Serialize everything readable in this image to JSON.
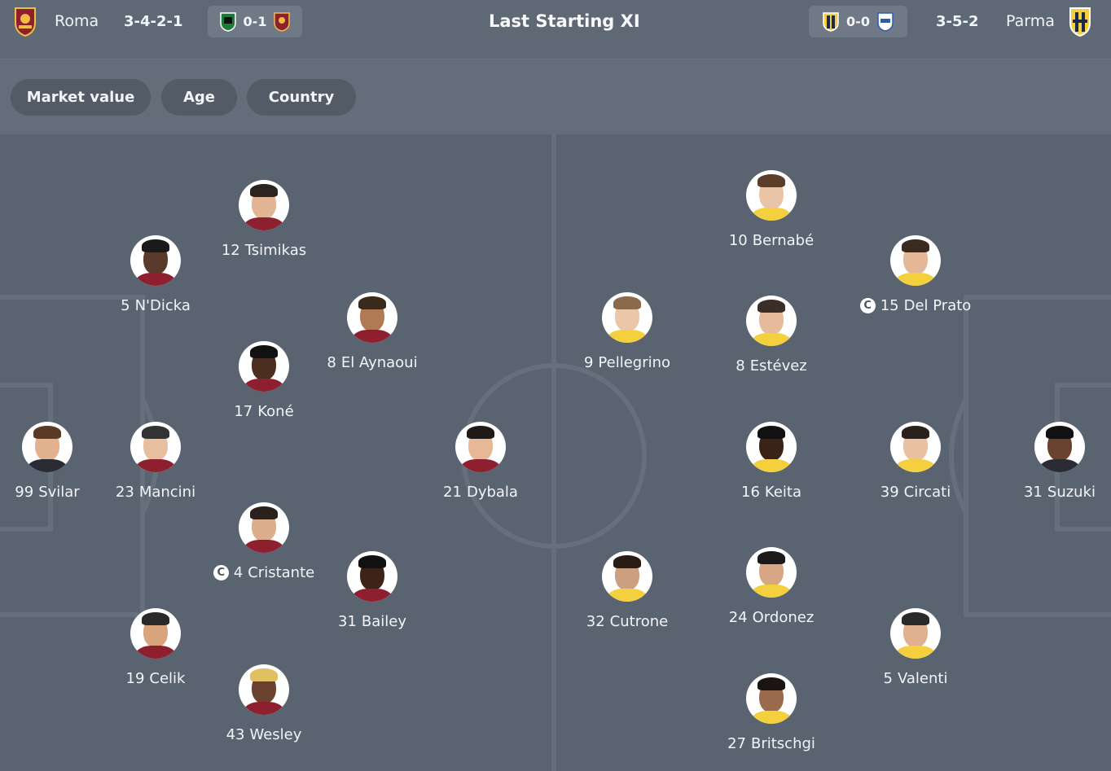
{
  "header": {
    "home": {
      "name": "Roma",
      "formation": "3-4-2-1",
      "last_result": "0-1"
    },
    "title": "Last Starting XI",
    "away": {
      "name": "Parma",
      "formation": "3-5-2",
      "last_result": "0-0"
    }
  },
  "filters": [
    {
      "label": "Market value"
    },
    {
      "label": "Age"
    },
    {
      "label": "Country"
    }
  ],
  "colors": {
    "background": "#5a6370",
    "header": "#5f6875",
    "chip": "#535b67",
    "roma_red": "#8e1f2f",
    "roma_gold": "#f0bc42",
    "parma_yellow": "#f4d03f"
  },
  "players": {
    "home": [
      {
        "number": "99",
        "name": "Svilar",
        "captain": false
      },
      {
        "number": "23",
        "name": "Mancini",
        "captain": false
      },
      {
        "number": "5",
        "name": "N'Dicka",
        "captain": false
      },
      {
        "number": "19",
        "name": "Celik",
        "captain": false
      },
      {
        "number": "12",
        "name": "Tsimikas",
        "captain": false
      },
      {
        "number": "17",
        "name": "Koné",
        "captain": false
      },
      {
        "number": "4",
        "name": "Cristante",
        "captain": true
      },
      {
        "number": "43",
        "name": "Wesley",
        "captain": false
      },
      {
        "number": "8",
        "name": "El Aynaoui",
        "captain": false
      },
      {
        "number": "31",
        "name": "Bailey",
        "captain": false
      },
      {
        "number": "21",
        "name": "Dybala",
        "captain": false
      }
    ],
    "away": [
      {
        "number": "31",
        "name": "Suzuki",
        "captain": false
      },
      {
        "number": "15",
        "name": "Del Prato",
        "captain": true
      },
      {
        "number": "39",
        "name": "Circati",
        "captain": false
      },
      {
        "number": "5",
        "name": "Valenti",
        "captain": false
      },
      {
        "number": "10",
        "name": "Bernabé",
        "captain": false
      },
      {
        "number": "8",
        "name": "Estévez",
        "captain": false
      },
      {
        "number": "16",
        "name": "Keita",
        "captain": false
      },
      {
        "number": "24",
        "name": "Ordonez",
        "captain": false
      },
      {
        "number": "27",
        "name": "Britschgi",
        "captain": false
      },
      {
        "number": "9",
        "name": "Pellegrino",
        "captain": false
      },
      {
        "number": "32",
        "name": "Cutrone",
        "captain": false
      }
    ]
  }
}
